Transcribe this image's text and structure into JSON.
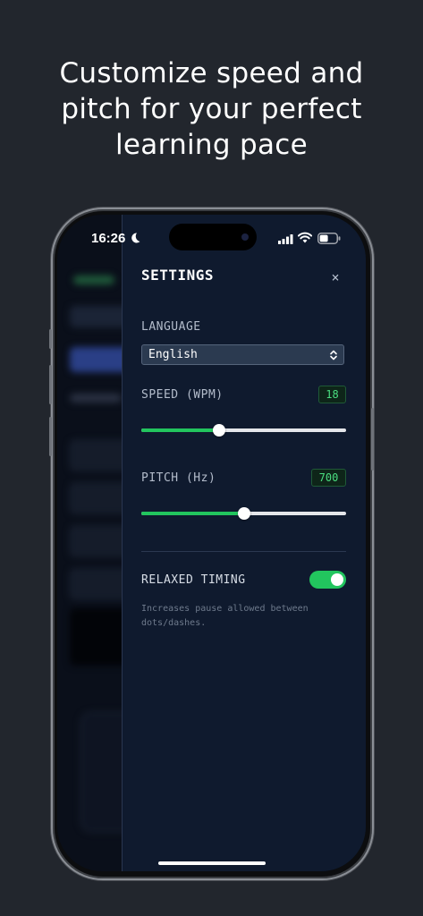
{
  "headline": {
    "line1": "Customize speed and",
    "line2": "pitch for your perfect",
    "line3": "learning pace"
  },
  "status_bar": {
    "time": "16:26",
    "icons": [
      "moon-icon",
      "signal-icon",
      "wifi-icon",
      "battery-icon"
    ]
  },
  "settings": {
    "title": "SETTINGS",
    "close_label": "×",
    "language": {
      "label": "LANGUAGE",
      "value": "English"
    },
    "speed": {
      "label": "SPEED (WPM)",
      "value": "18",
      "fraction": 0.38
    },
    "pitch": {
      "label": "PITCH (Hz)",
      "value": "700",
      "fraction": 0.5
    },
    "relaxed_timing": {
      "label": "RELAXED TIMING",
      "enabled": true,
      "description": "Increases pause allowed between dots/dashes."
    }
  },
  "colors": {
    "accent": "#22c55e",
    "badge_text": "#4ade80",
    "panel_bg": "#0f1a2e",
    "page_bg": "#22262d"
  }
}
